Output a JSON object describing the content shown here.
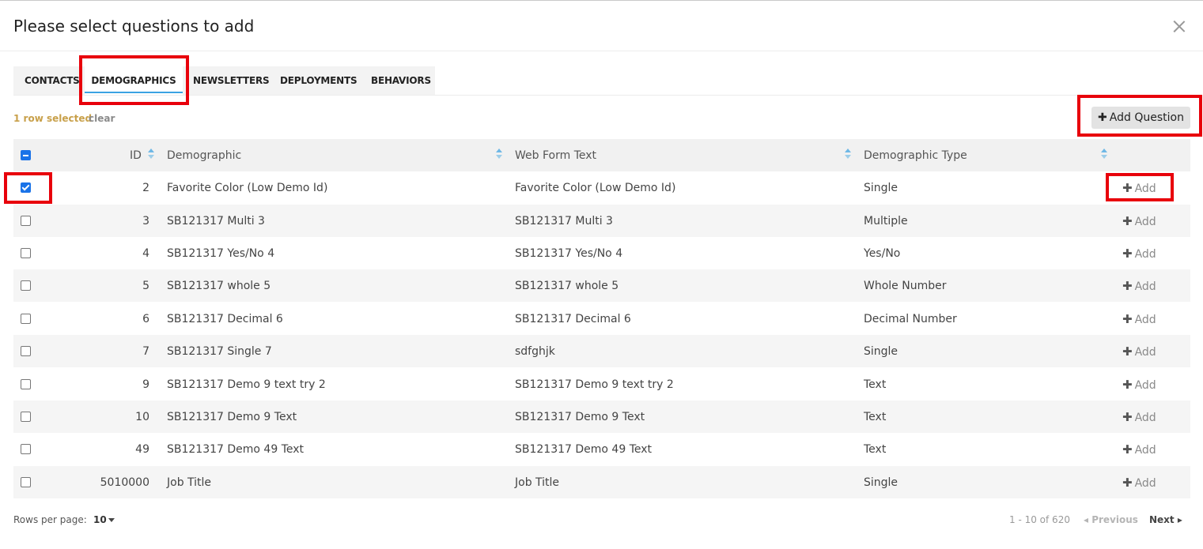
{
  "modal": {
    "title": "Please select questions to add",
    "close_icon": "close-icon"
  },
  "tabs": [
    {
      "label": "CONTACTS",
      "active": false
    },
    {
      "label": "DEMOGRAPHICS",
      "active": true
    },
    {
      "label": "NEWSLETTERS",
      "active": false
    },
    {
      "label": "DEPLOYMENTS",
      "active": false
    },
    {
      "label": "BEHAVIORS",
      "active": false
    }
  ],
  "selection": {
    "count_text": "1 row selected",
    "clear_label": "clear"
  },
  "toolbar": {
    "add_question_icon": "plus-icon",
    "add_question_plus": "✚",
    "add_question_label": "Add Question"
  },
  "table": {
    "columns": [
      "ID",
      "Demographic",
      "Web Form Text",
      "Demographic Type"
    ],
    "add_label": "Add",
    "add_plus": "✚",
    "rows": [
      {
        "id": "2",
        "demographic": "Favorite Color (Low Demo Id)",
        "web_form_text": "Favorite Color (Low Demo Id)",
        "type": "Single",
        "checked": true
      },
      {
        "id": "3",
        "demographic": "SB121317 Multi 3",
        "web_form_text": "SB121317 Multi 3",
        "type": "Multiple",
        "checked": false
      },
      {
        "id": "4",
        "demographic": "SB121317 Yes/No 4",
        "web_form_text": "SB121317 Yes/No 4",
        "type": "Yes/No",
        "checked": false
      },
      {
        "id": "5",
        "demographic": "SB121317 whole 5",
        "web_form_text": "SB121317 whole 5",
        "type": "Whole Number",
        "checked": false
      },
      {
        "id": "6",
        "demographic": "SB121317 Decimal 6",
        "web_form_text": "SB121317 Decimal 6",
        "type": "Decimal Number",
        "checked": false
      },
      {
        "id": "7",
        "demographic": "SB121317 Single 7",
        "web_form_text": "sdfghjk",
        "type": "Single",
        "checked": false
      },
      {
        "id": "9",
        "demographic": "SB121317 Demo 9 text try 2",
        "web_form_text": "SB121317 Demo 9 text try 2",
        "type": "Text",
        "checked": false
      },
      {
        "id": "10",
        "demographic": "SB121317 Demo 9 Text",
        "web_form_text": "SB121317 Demo 9 Text",
        "type": "Text",
        "checked": false
      },
      {
        "id": "49",
        "demographic": "SB121317 Demo 49 Text",
        "web_form_text": "SB121317 Demo 49 Text",
        "type": "Text",
        "checked": false
      },
      {
        "id": "5010000",
        "demographic": "Job Title",
        "web_form_text": "Job Title",
        "type": "Single",
        "checked": false
      }
    ]
  },
  "pagination": {
    "rows_per_page_label": "Rows per page:",
    "rows_per_page_value": "10",
    "range_text": "1 - 10 of 620",
    "previous_label": "Previous",
    "next_label": "Next"
  },
  "colors": {
    "highlight": "#e8000b",
    "accent": "#1a73e8",
    "tab_underline": "#3aa3e3",
    "selection_text": "#c8a04a"
  }
}
